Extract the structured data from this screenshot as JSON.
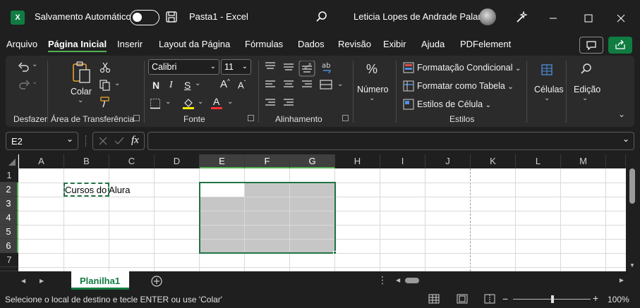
{
  "titlebar": {
    "autosave_label": "Salvamento Automático",
    "filename": "Pasta1",
    "separator": "-",
    "app": "Excel",
    "user": "Leticia Lopes de Andrade Palaro",
    "logo_letter": "X"
  },
  "menu": [
    "Arquivo",
    "Página Inicial",
    "Inserir",
    "Layout da Página",
    "Fórmulas",
    "Dados",
    "Revisão",
    "Exibir",
    "Ajuda",
    "PDFelement"
  ],
  "ribbon": {
    "undo_label": "Desfazer",
    "clipboard_label": "Área de Transferência",
    "paste_label": "Colar",
    "font_group": "Fonte",
    "font_name": "Calibri",
    "font_size": "11",
    "bold": "N",
    "italic": "I",
    "underline": "S",
    "grow_font": "A",
    "shrink_font": "A",
    "font_color_letter": "A",
    "alignment_label": "Alinhamento",
    "number_label": "Número",
    "number_icon": "%",
    "styles_label": "Estilos",
    "conditional": "Formatação Condicional",
    "table_format": "Formatar como Tabela",
    "cell_styles": "Estilos de Célula",
    "cells_label": "Células",
    "edit_label": "Edição"
  },
  "formula": {
    "namebox": "E2",
    "fx": "fx",
    "content": ""
  },
  "columns": [
    "A",
    "B",
    "C",
    "D",
    "E",
    "F",
    "G",
    "H",
    "I",
    "J",
    "K",
    "L",
    "M"
  ],
  "rows": [
    "1",
    "2",
    "3",
    "4",
    "5",
    "6",
    "7"
  ],
  "cells": {
    "B2": "Cursos do Alura"
  },
  "sheet_tab": "Planilha1",
  "status": {
    "message": "Selecione o local de destino e tecle ENTER ou use 'Colar'",
    "zoom": "100%"
  },
  "colors": {
    "accent": "#54b054",
    "selection": "#c6c6c6",
    "excel_green": "#107c41"
  }
}
